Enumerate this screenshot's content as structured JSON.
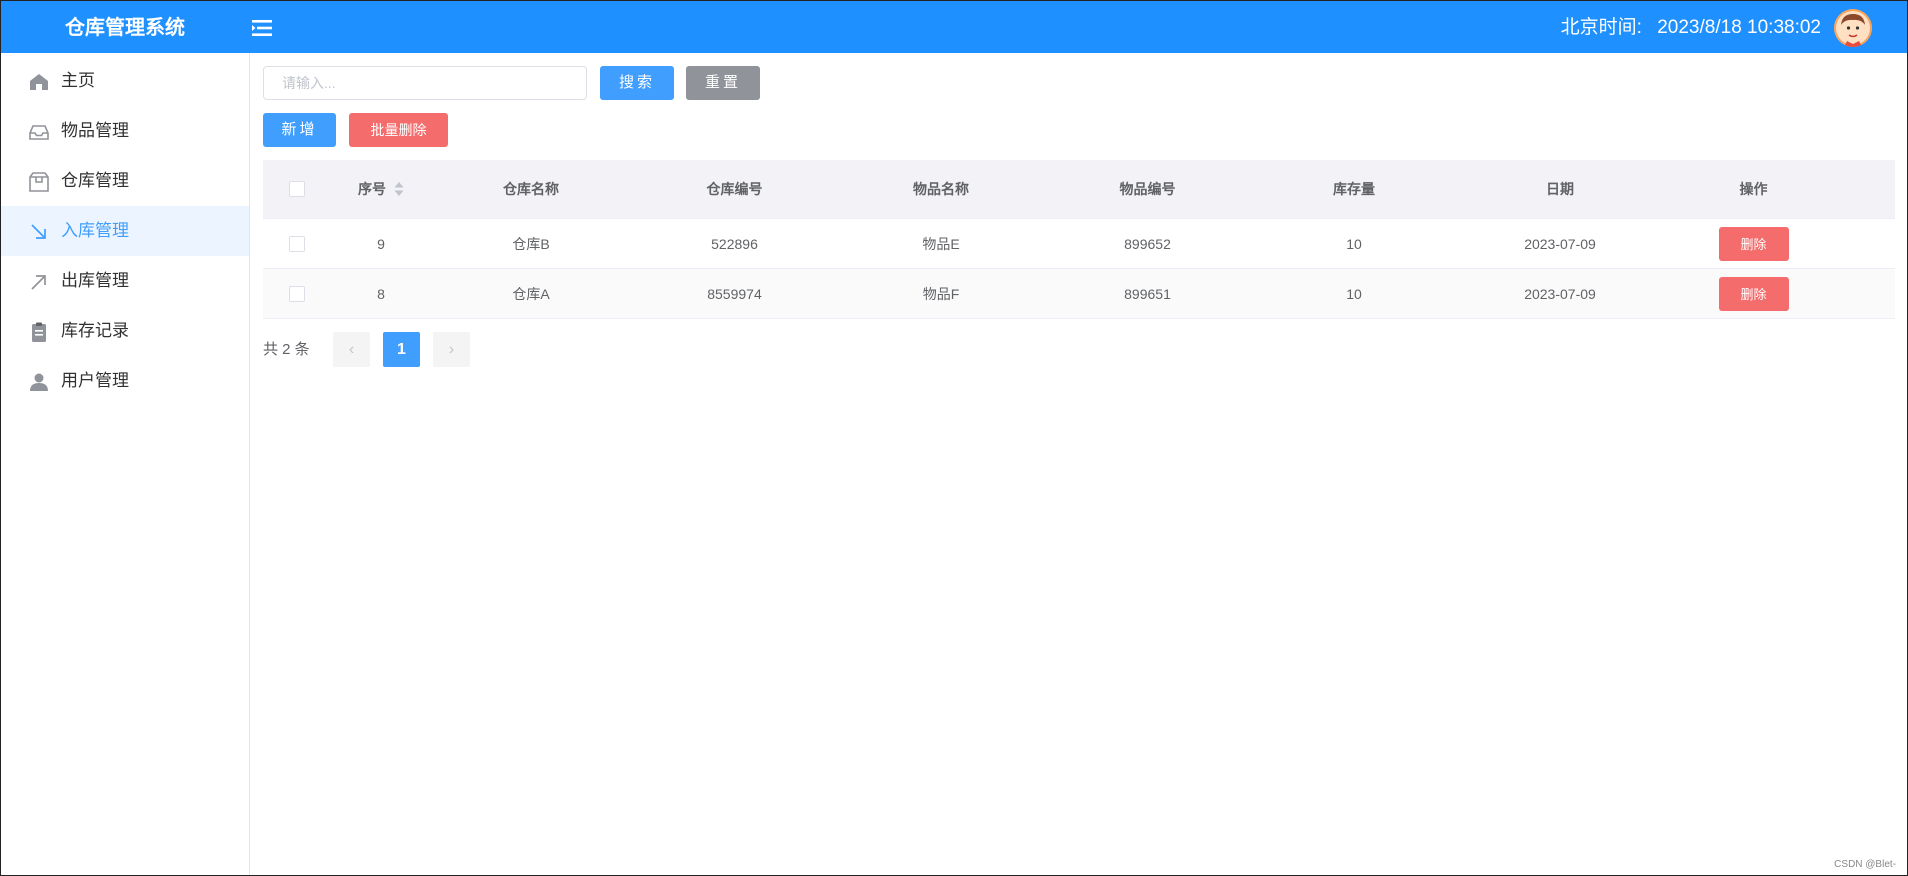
{
  "header": {
    "brand": "仓库管理系统",
    "clock_label": "北京时间:",
    "clock_value": "2023/8/18 10:38:02",
    "accent": "#1e90ff"
  },
  "sidebar": {
    "items": [
      {
        "label": "主页",
        "icon": "home-icon",
        "active": false
      },
      {
        "label": "物品管理",
        "icon": "inbox-icon",
        "active": false
      },
      {
        "label": "仓库管理",
        "icon": "box-icon",
        "active": false
      },
      {
        "label": "入库管理",
        "icon": "arrow-down-right-icon",
        "active": true
      },
      {
        "label": "出库管理",
        "icon": "arrow-up-right-icon",
        "active": false
      },
      {
        "label": "库存记录",
        "icon": "clipboard-icon",
        "active": false
      },
      {
        "label": "用户管理",
        "icon": "user-icon",
        "active": false
      }
    ]
  },
  "toolbar": {
    "search_placeholder": "请输入...",
    "search_label": "搜索",
    "reset_label": "重置",
    "add_label": "新增",
    "batch_delete_label": "批量删除"
  },
  "table": {
    "columns": [
      "序号",
      "仓库名称",
      "仓库编号",
      "物品名称",
      "物品编号",
      "库存量",
      "日期",
      "操作"
    ],
    "rows": [
      {
        "id": "9",
        "warehouse": "仓库B",
        "warehouse_no": "522896",
        "item": "物品E",
        "item_no": "899652",
        "qty": "10",
        "date": "2023-07-09",
        "action": "删除"
      },
      {
        "id": "8",
        "warehouse": "仓库A",
        "warehouse_no": "8559974",
        "item": "物品F",
        "item_no": "899651",
        "qty": "10",
        "date": "2023-07-09",
        "action": "删除"
      }
    ]
  },
  "pagination": {
    "total_text": "共 2 条",
    "current_page": "1",
    "prev": "‹",
    "next": "›"
  },
  "watermark": "CSDN @Blet-"
}
